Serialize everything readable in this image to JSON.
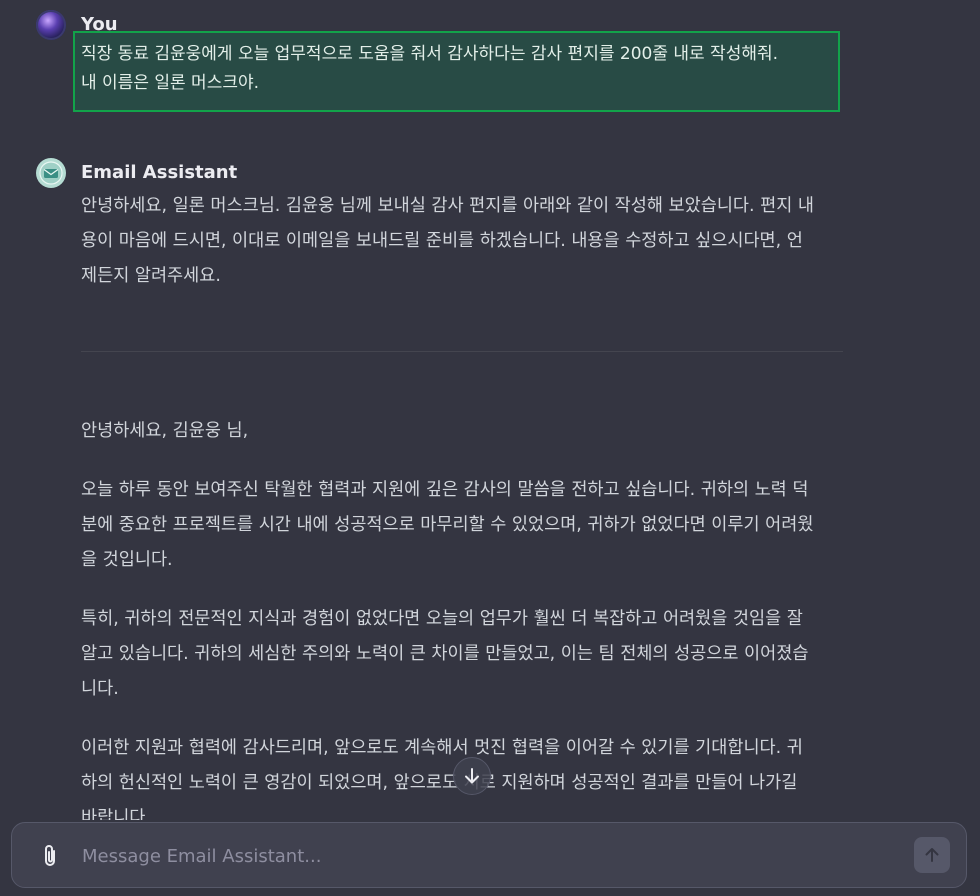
{
  "conversation": {
    "user": {
      "name": "You",
      "message_lines": [
        "직장 동료 김윤웅에게 오늘 업무적으로 도움을 줘서 감사하다는 감사 편지를 200줄 내로 작성해줘.",
        "내 이름은 일론 머스크야."
      ]
    },
    "assistant": {
      "name": "Email Assistant",
      "intro_lines": [
        "안녕하세요, 일론 머스크님. 김윤웅 님께 보내실 감사 편지를 아래와 같이 작성해 보았습니다. 편지 내",
        "용이 마음에 드시면, 이대로 이메일을 보내드릴 준비를 하겠습니다. 내용을 수정하고 싶으시다면, 언",
        "제든지 알려주세요."
      ],
      "letter_paragraphs": [
        [
          "안녕하세요, 김윤웅 님,"
        ],
        [
          "오늘 하루 동안 보여주신 탁월한 협력과 지원에 깊은 감사의 말씀을 전하고 싶습니다. 귀하의 노력 덕",
          "분에 중요한 프로젝트를 시간 내에 성공적으로 마무리할 수 있었으며, 귀하가 없었다면 이루기 어려웠",
          "을 것입니다."
        ],
        [
          "특히, 귀하의 전문적인 지식과 경험이 없었다면 오늘의 업무가 훨씬 더 복잡하고 어려웠을 것임을 잘",
          "알고 있습니다. 귀하의 세심한 주의와 노력이 큰 차이를 만들었고, 이는 팀 전체의 성공으로 이어졌습",
          "니다."
        ],
        [
          "이러한 지원과 협력에 감사드리며, 앞으로도 계속해서 멋진 협력을 이어갈 수 있기를 기대합니다. 귀",
          "하의 헌신적인 노력이 큰 영감이 되었으며, 앞으로도 서로 지원하며 성공적인 결과를 만들어 나가길",
          "바랍니다."
        ]
      ]
    }
  },
  "composer": {
    "placeholder": "Message Email Assistant..."
  },
  "icons": {
    "user_avatar": "user-avatar",
    "assistant_avatar": "envelope-avatar-icon",
    "attach": "paperclip-icon",
    "send": "arrow-up-icon",
    "scroll_down": "arrow-down-icon"
  },
  "colors": {
    "background": "#343541",
    "user_bubble": "#284b45",
    "highlight_border": "#12a34a",
    "assistant_avatar": "#b5dcd3"
  }
}
